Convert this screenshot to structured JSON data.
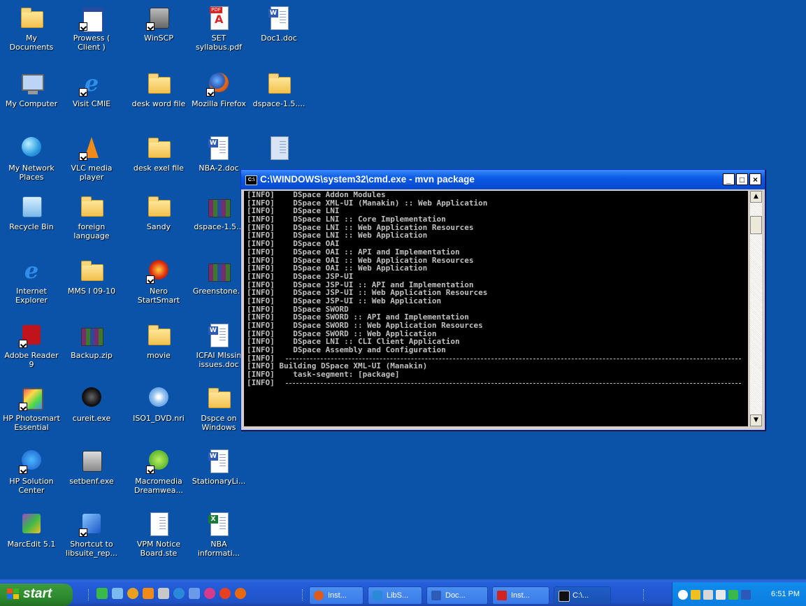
{
  "desktop": {
    "icons": [
      {
        "label": "My Documents"
      },
      {
        "label": "Prowess ( Client )"
      },
      {
        "label": "WinSCP"
      },
      {
        "label": "SET syllabus.pdf"
      },
      {
        "label": "Doc1.doc"
      },
      {
        "label": "My Computer"
      },
      {
        "label": "Visit CMIE"
      },
      {
        "label": "desk word file"
      },
      {
        "label": "Mozilla Firefox"
      },
      {
        "label": "dspace-1.5...."
      },
      {
        "label": "My Network Places"
      },
      {
        "label": "VLC media player"
      },
      {
        "label": "desk exel file"
      },
      {
        "label": "NBA-2.doc"
      },
      {
        "label": "Recycle Bin"
      },
      {
        "label": "foreign language"
      },
      {
        "label": "Sandy"
      },
      {
        "label": "dspace-1.5..."
      },
      {
        "label": "Internet Explorer"
      },
      {
        "label": "MMS I 09-10"
      },
      {
        "label": "Nero StartSmart"
      },
      {
        "label": "Greenstone..."
      },
      {
        "label": "Adobe Reader 9"
      },
      {
        "label": "Backup.zip"
      },
      {
        "label": "movie"
      },
      {
        "label": "ICFAI MIssin issues.doc"
      },
      {
        "label": "HP Photosmart Essential"
      },
      {
        "label": "cureit.exe"
      },
      {
        "label": "ISO1_DVD.nri"
      },
      {
        "label": "Dspce on Windows"
      },
      {
        "label": "HP Solution Center"
      },
      {
        "label": "setbenf.exe"
      },
      {
        "label": "Macromedia Dreamwea..."
      },
      {
        "label": "StationaryLi..."
      },
      {
        "label": "MarcEdit 5.1"
      },
      {
        "label": "Shortcut to libsuite_rep..."
      },
      {
        "label": "VPM Notice Board.ste"
      },
      {
        "label": "NBA informati..."
      }
    ]
  },
  "cmd_window": {
    "title": "C:\\WINDOWS\\system32\\cmd.exe - mvn package",
    "title_icon": "C:\\",
    "lines": [
      "[INFO]    DSpace Addon Modules",
      "[INFO]    DSpace XML-UI (Manakin) :: Web Application",
      "[INFO]    DSpace LNI",
      "[INFO]    DSpace LNI :: Core Implementation",
      "[INFO]    DSpace LNI :: Web Application Resources",
      "[INFO]    DSpace LNI :: Web Application",
      "[INFO]    DSpace OAI",
      "[INFO]    DSpace OAI :: API and Implementation",
      "[INFO]    DSpace OAI :: Web Application Resources",
      "[INFO]    DSpace OAI :: Web Application",
      "[INFO]    DSpace JSP-UI",
      "[INFO]    DSpace JSP-UI :: API and Implementation",
      "[INFO]    DSpace JSP-UI :: Web Application Resources",
      "[INFO]    DSpace JSP-UI :: Web Application",
      "[INFO]    DSpace SWORD",
      "[INFO]    DSpace SWORD :: API and Implementation",
      "[INFO]    DSpace SWORD :: Web Application Resources",
      "[INFO]    DSpace SWORD :: Web Application",
      "[INFO]    DSpace LNI :: CLI Client Application",
      "[INFO]    DSpace Assembly and Configuration",
      "[INFO]",
      "[INFO] Building DSpace XML-UI (Manakin)",
      "[INFO]    task-segment: [package]",
      "[INFO]"
    ],
    "buttons": {
      "minimize": "_",
      "maximize": "□",
      "close": "×"
    },
    "scroll": {
      "up": "▲",
      "down": "▼"
    }
  },
  "taskbar": {
    "start_label": "start",
    "tasks": [
      {
        "label": "Inst...",
        "color": "#e05a1a"
      },
      {
        "label": "LibS...",
        "color": "#2a8ad8"
      },
      {
        "label": "Doc...",
        "color": "#2d5bb8"
      },
      {
        "label": "Inst...",
        "color": "#d22222"
      },
      {
        "label": "C:\\...",
        "color": "#111111"
      }
    ],
    "clock": "6:51 PM"
  },
  "colors": {
    "desktop": "#0a53a8",
    "title_bar": "#0a5ae6",
    "console_bg": "#000000",
    "console_text": "#c0c0c0",
    "start_green": "#2e8b2e"
  }
}
